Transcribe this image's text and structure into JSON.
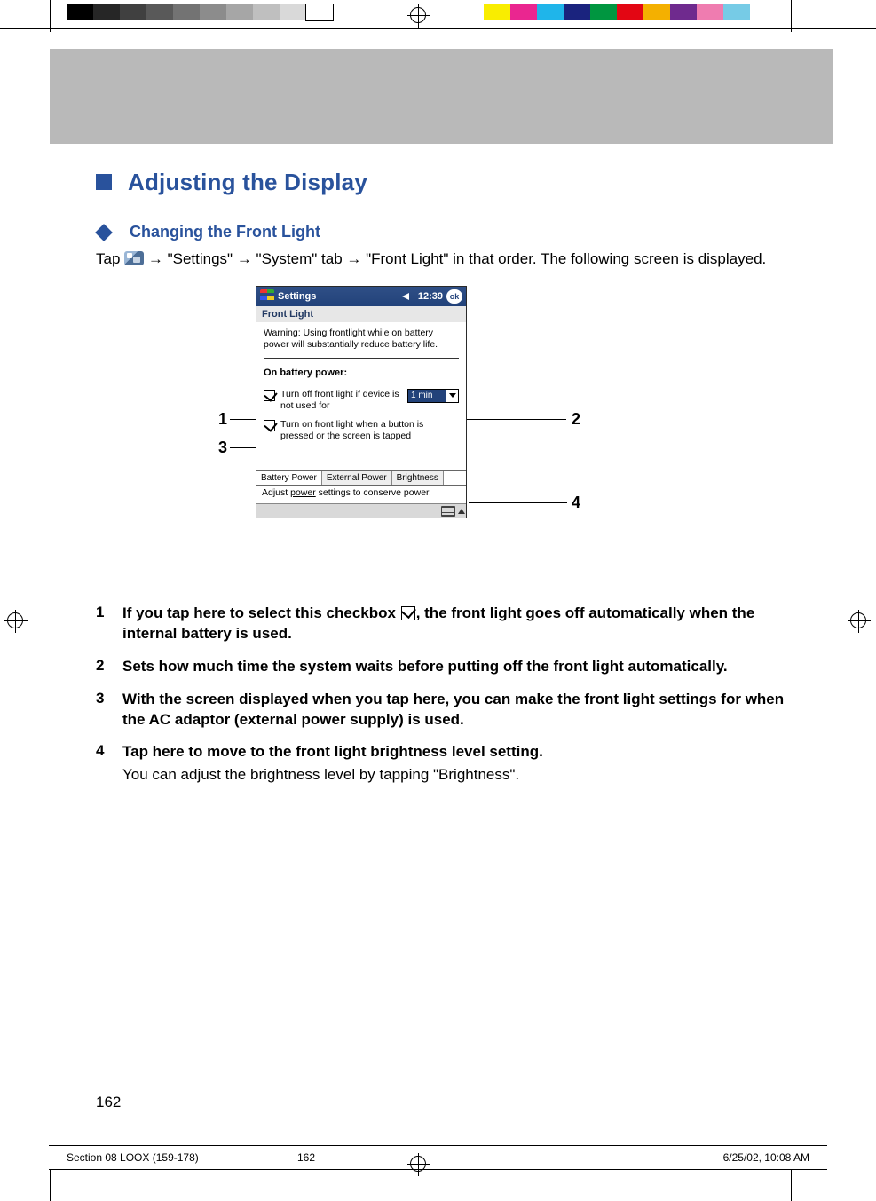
{
  "main": {
    "heading": "Adjusting the Display",
    "subheading": "Changing the Front Light",
    "intro_pre": "Tap ",
    "intro_mid": " → \"Settings\" → \"System\" tab → \"Front Light\" in that order. The following screen is displayed.",
    "page_number": "162"
  },
  "screenshot": {
    "titlebar_title": "Settings",
    "titlebar_time": "12:39",
    "titlebar_ok": "ok",
    "subtitle": "Front Light",
    "warning": "Warning: Using frontlight while on battery power will substantially reduce battery life.",
    "on_battery_label": "On battery power:",
    "opt1_text": "Turn off front light if device is not used for",
    "opt1_dropdown": "1 min",
    "opt2_text": "Turn on front light when a button is pressed or the screen is tapped",
    "tabs": [
      "Battery Power",
      "External Power",
      "Brightness"
    ],
    "hint_pre": "Adjust ",
    "hint_link": "power",
    "hint_post": " settings to conserve power."
  },
  "callouts": {
    "c1": "1",
    "c2": "2",
    "c3": "3",
    "c4": "4"
  },
  "explain": {
    "items": [
      {
        "num": "1",
        "bold_pre": "If you tap here to select this checkbox ",
        "bold_post": ", the front light goes off automatically when the internal battery is used."
      },
      {
        "num": "2",
        "bold": "Sets how much time the system waits before putting off the front light automatically."
      },
      {
        "num": "3",
        "bold": "With the screen displayed when you tap here, you can make the front light settings for when the AC adaptor (external power supply) is used."
      },
      {
        "num": "4",
        "bold": "Tap here to move to the front light brightness level setting.",
        "normal": "You can adjust the brightness level by tapping \"Brightness\"."
      }
    ]
  },
  "footer": {
    "slug": "Section 08 LOOX (159-178)",
    "page": "162",
    "timestamp": "6/25/02, 10:08 AM"
  },
  "swatches": {
    "greys": [
      "#000000",
      "#262626",
      "#404040",
      "#595959",
      "#737373",
      "#8c8c8c",
      "#a6a6a6",
      "#bfbfbf",
      "#d9d9d9",
      "#ffffff"
    ],
    "colors": [
      "#f9ed00",
      "#ea2690",
      "#1fb5ea",
      "#1a237e",
      "#009640",
      "#e30613",
      "#f4b000",
      "#6f2a8e",
      "#ef7cb0",
      "#76cbe6"
    ]
  }
}
